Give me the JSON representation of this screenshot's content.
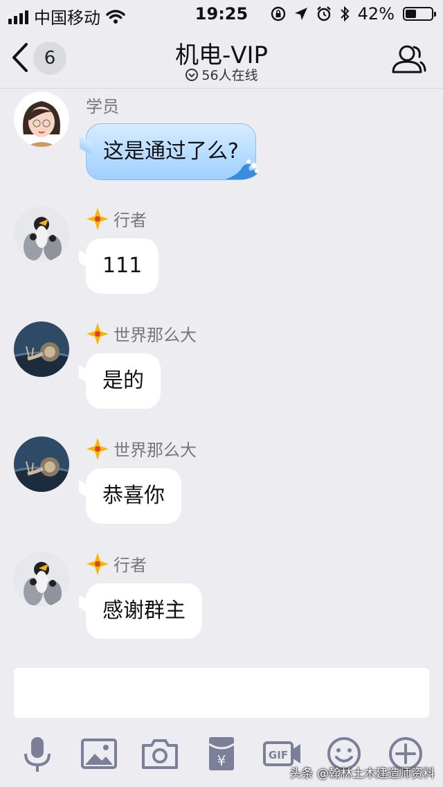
{
  "status": {
    "carrier": "中国移动",
    "time": "19:25",
    "battery": "42%",
    "battery_level": 0.42
  },
  "nav": {
    "unread_count": "6",
    "title": "机电-VIP",
    "online": "56人在线"
  },
  "messages": [
    {
      "sender": "学员",
      "text": "这是通过了么?",
      "style": "blue",
      "avatar": "girl-avatar",
      "vip": false
    },
    {
      "sender": "行者",
      "text": "111",
      "style": "white",
      "avatar": "penguin-avatar",
      "vip": true
    },
    {
      "sender": "世界那么大",
      "text": "是的",
      "style": "white",
      "avatar": "snail-avatar",
      "vip": true
    },
    {
      "sender": "世界那么大",
      "text": "恭喜你",
      "style": "white",
      "avatar": "snail-avatar",
      "vip": true
    },
    {
      "sender": "行者",
      "text": "感谢群主",
      "style": "white",
      "avatar": "penguin-avatar",
      "vip": true
    }
  ],
  "input": {
    "value": ""
  },
  "toolbar": [
    "microphone-icon",
    "image-icon",
    "camera-icon",
    "red-packet-icon",
    "gif-icon",
    "emoji-icon",
    "plus-icon"
  ],
  "watermark": "头条 @翰林土木建造师资料",
  "colors": {
    "background": "#ececf1",
    "icon": "#7c7f98",
    "blue_bubble": "#9fd0ff",
    "vip": "#f5b800"
  }
}
